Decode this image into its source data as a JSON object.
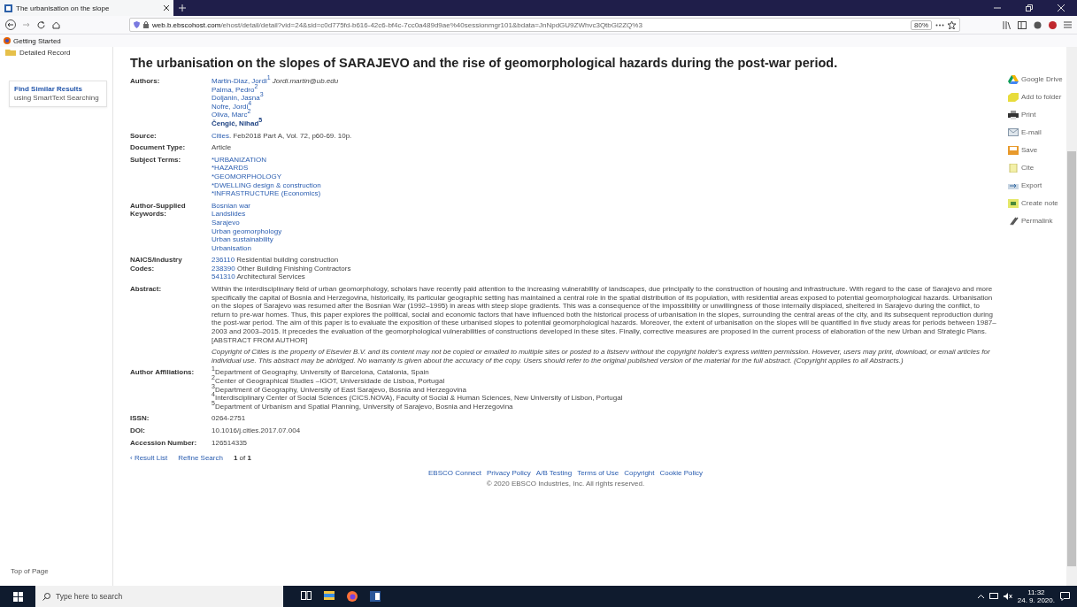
{
  "browser": {
    "tab_title": "The urbanisation on the slope",
    "url_host": "web.b.ebscohost.com",
    "url_path": "/ehost/detail/detail?vid=24&sid=c0d775fd-b616-42c6-bf4c-7cc0a489d9ae%40sessionmgr101&bdata=JnNpdGU9ZWhvc3QtbGl2ZQ%3",
    "zoom": "80%",
    "bookmarks": [
      "Getting Started"
    ]
  },
  "page": {
    "breadcrumb": "Detailed Record",
    "similar": {
      "link": "Find Similar Results",
      "text": "using SmartText Searching"
    },
    "title": "The urbanisation on the slopes of SARAJEVO and the rise of geomorphological hazards during the post-war period.",
    "fields": [
      {
        "label": "Authors:",
        "kind": "authors",
        "items": [
          {
            "name": "Martin-Diaz, Jordi$^{1}$",
            "email": "Jordi.martin@ub.edu",
            "highlighted": false
          },
          {
            "name": "Palma, Pedro$^{2}$",
            "highlighted": false
          },
          {
            "name": "Doljanin, Jasna$^{3}$",
            "highlighted": false
          },
          {
            "name": "Nofre, Jordi$^{4}$",
            "highlighted": false
          },
          {
            "name": "Oliva, Marc$^{2}$",
            "highlighted": false
          },
          {
            "name": "Čengić, Nihad$^{5}$",
            "highlighted": true
          }
        ]
      },
      {
        "label": "Source:",
        "kind": "source",
        "link": "Cities",
        "text": ". Feb2018 Part A, Vol. 72, p60-69. 10p."
      },
      {
        "label": "Document Type:",
        "kind": "text",
        "value": "Article"
      },
      {
        "label": "Subject Terms:",
        "kind": "links",
        "items": [
          "*URBANIZATION",
          "*HAZARDS",
          "*GEOMORPHOLOGY",
          "*DWELLING design & construction",
          "*INFRASTRUCTURE (Economics)"
        ]
      },
      {
        "label": "Author-Supplied Keywords:",
        "kind": "links",
        "items": [
          "Bosnian war",
          "Landslides",
          "Sarajevo",
          "Urban geomorphology",
          "Urban sustainability",
          "Urbanisation"
        ]
      },
      {
        "label": "NAICS/Industry Codes:",
        "kind": "codes",
        "items": [
          {
            "code": "236110",
            "description": "Residential building construction"
          },
          {
            "code": "238390",
            "description": "Other Building Finishing Contractors"
          },
          {
            "code": "541310",
            "description": "Architectural Services"
          }
        ]
      },
      {
        "label": "Abstract:",
        "kind": "abstract",
        "value": "Within the interdisciplinary field of urban geomorphology, scholars have recently paid attention to the increasing vulnerability of landscapes, due principally to the construction of housing and infrastructure. With regard to the case of Sarajevo and more specifically the capital of Bosnia and Herzegovina, historically, its particular geographic setting has maintained a central role in the spatial distribution of its population, with residential areas exposed to potential geomorphological hazards. Urbanisation on the slopes of Sarajevo was resumed after the Bosnian War (1992–1995) in areas with steep slope gradients. This was a consequence of the impossibility or unwillingness of those internally displaced, sheltered in Sarajevo during the conflict, to return to pre-war homes. Thus, this paper explores the political, social and economic factors that have influenced both the historical process of urbanisation in the slopes, surrounding the central areas of the city, and its subsequent reproduction during the post-war period. The aim of this paper is to evaluate the exposition of these urbanised slopes to potential geomorphological hazards. Moreover, the extent of urbanisation on the slopes will be quantified in five study areas for periods between 1987–2003 and 2003–2015. It precedes the evaluation of the geomorphological vulnerabilities of constructions developed in these sites. Finally, corrective measures are proposed in the current process of elaboration of the new Urban and Strategic Plans. [ABSTRACT FROM AUTHOR]",
        "copyright": "Copyright of Cities is the property of Elsevier B.V. and its content may not be copied or emailed to multiple sites or posted to a listserv without the copyright holder's express written permission. However, users may print, download, or email articles for individual use. This abstract may be abridged. No warranty is given about the accuracy of the copy. Users should refer to the original published version of the material for the full abstract. (Copyright applies to all Abstracts.)"
      },
      {
        "label": "Author Affiliations:",
        "kind": "affiliations",
        "items": [
          "$^{1}$Department of Geography, University of Barcelona, Catalonia, Spain",
          "$^{2}$Center of Geographical Studies –IGOT, Universidade de Lisboa, Portugal",
          "$^{3}$Department of Geography, University of East Sarajevo, Bosnia and Herzegovina",
          "$^{4}$Interdisciplinary Center of Social Sciences (CICS.NOVA), Faculty of Social & Human Sciences, New University of Lisbon, Portugal",
          "$^{5}$Department of Urbanism and Spatial Planning, University of Sarajevo, Bosnia and Herzegovina"
        ]
      },
      {
        "label": "ISSN:",
        "kind": "text",
        "value": "0264-2751"
      },
      {
        "label": "DOI:",
        "kind": "text",
        "value": "10.1016/j.cities.2017.07.004"
      },
      {
        "label": "Accession Number:",
        "kind": "text",
        "value": "126514335"
      }
    ],
    "nav": {
      "result_list": "‹ Result List",
      "refine": "Refine Search",
      "position": "**1** of **1**"
    },
    "tools": [
      "Google Drive",
      "Add to folder",
      "Print",
      "E-mail",
      "Save",
      "Cite",
      "Export",
      "Create note",
      "Permalink"
    ],
    "top_link": "Top of Page",
    "footer": {
      "links": [
        "EBSCO Connect",
        "Privacy Policy",
        "A/B Testing",
        "Terms of Use",
        "Copyright",
        "Cookie Policy"
      ],
      "copyright": "© 2020 EBSCO Industries, Inc. All rights reserved."
    }
  },
  "taskbar": {
    "search_placeholder": "Type here to search",
    "time": "11:32",
    "date": "24. 9. 2020."
  }
}
